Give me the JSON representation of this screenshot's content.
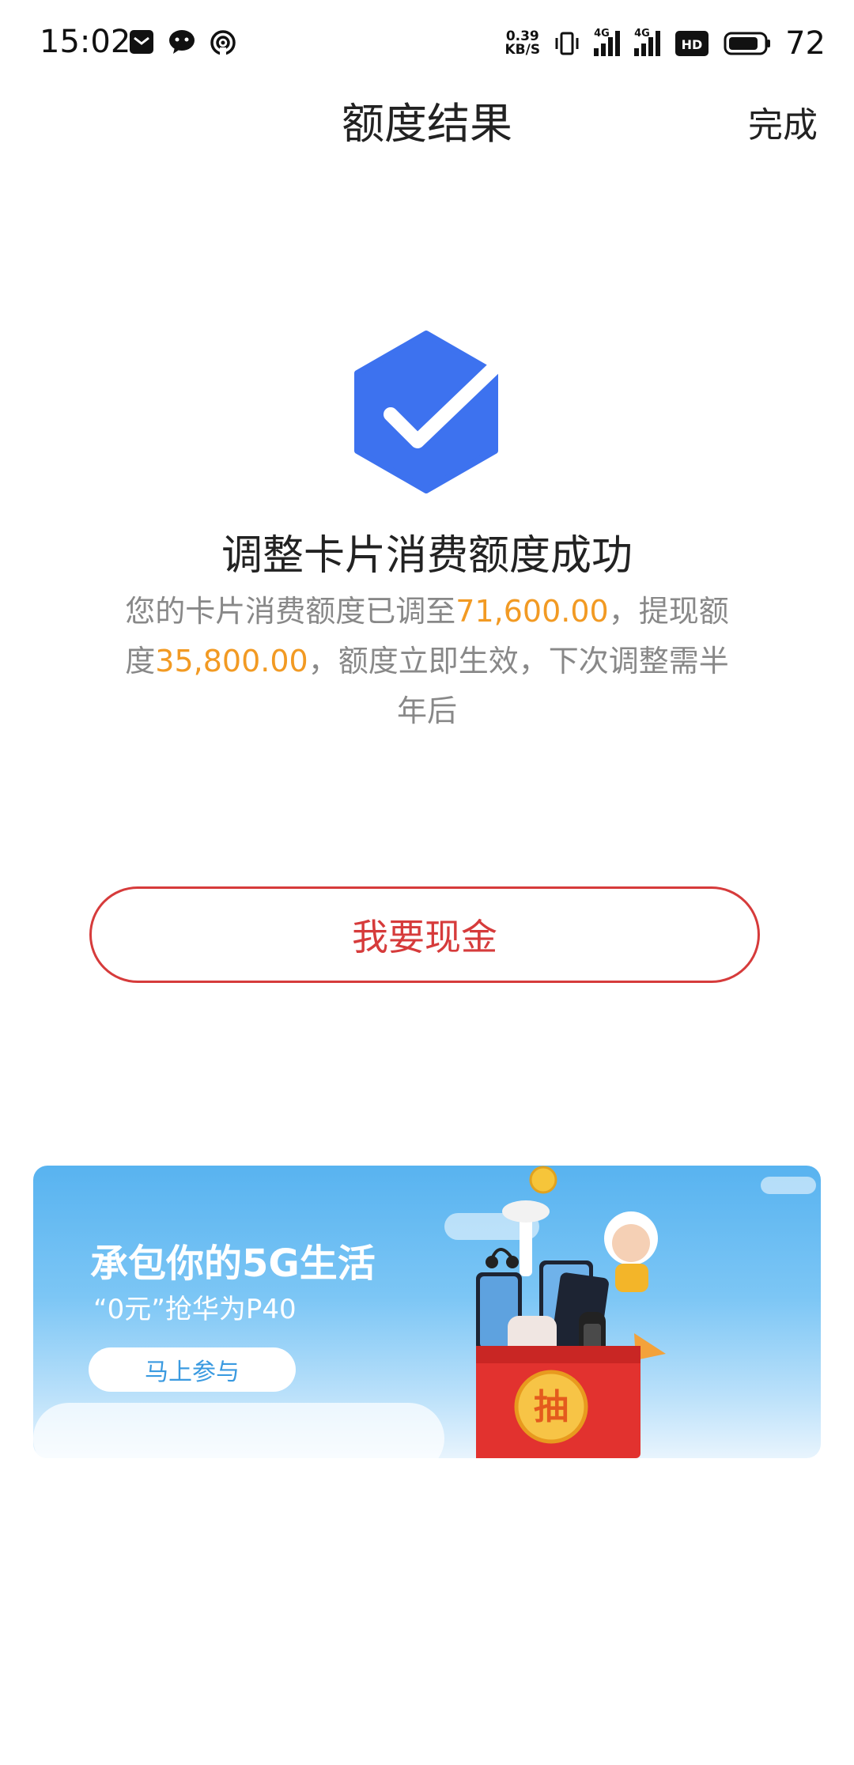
{
  "status_bar": {
    "time": "15:02",
    "net_speed_value": "0.39",
    "net_speed_unit": "KB/S",
    "signal_labels": [
      "4G",
      "4G"
    ],
    "battery": "72",
    "icons": [
      "mail-icon",
      "chat-bubble-icon",
      "hotspot-icon",
      "vibrate-icon",
      "signal-icon",
      "hd-icon",
      "battery-icon"
    ]
  },
  "nav": {
    "title": "额度结果",
    "done_label": "完成"
  },
  "result": {
    "title": "调整卡片消费额度成功",
    "desc_part1": "您的卡片消费额度已调至",
    "consume_limit": "71,600.00",
    "desc_part2": "，提现额度",
    "cash_limit": "35,800.00",
    "desc_part3": "，额度立即生效，下次调整需半年后"
  },
  "cash_button": {
    "label": "我要现金"
  },
  "banner": {
    "title": "承包你的5G生活",
    "subtitle": "“0元”抢华为P40",
    "button_label": "马上参与",
    "prize_box_char": "抽"
  },
  "colors": {
    "accent_blue": "#3d72ef",
    "highlight_orange": "#f29a23",
    "button_red": "#d63b3b"
  }
}
